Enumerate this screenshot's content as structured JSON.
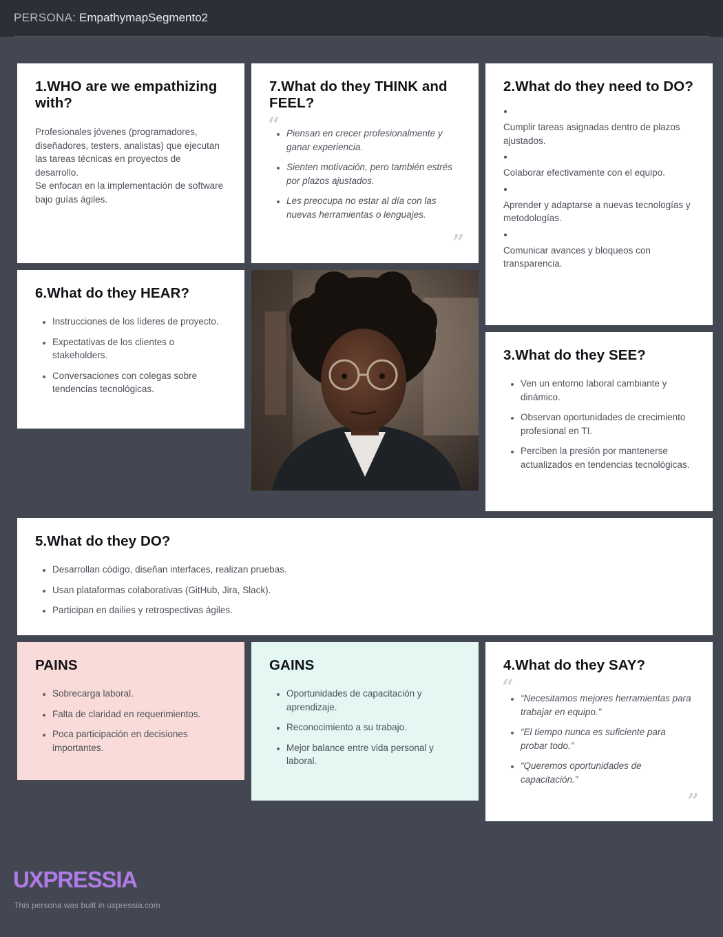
{
  "header": {
    "persona_label": "PERSONA:",
    "persona_name": "EmpathymapSegmento2"
  },
  "who": {
    "title": "1.WHO are we empathizing with?",
    "text_1": "Profesionales jóvenes (programadores, diseñadores, testers, analistas) que ejecutan las tareas técnicas en proyectos de desarrollo.",
    "text_2": "Se enfocan en la implementación de software bajo guías ágiles."
  },
  "think_feel": {
    "title": "7.What do they THINK and FEEL?",
    "items": [
      "Piensan en crecer profesionalmente y ganar experiencia.",
      "Sienten motivación, pero también estrés por plazos ajustados.",
      "Les preocupa no estar al día con las nuevas herramientas o lenguajes."
    ]
  },
  "need_to_do": {
    "title": "2.What do they need to DO?",
    "items": [
      "Cumplir tareas asignadas dentro de plazos ajustados.",
      "Colaborar efectivamente con el equipo.",
      "Aprender y adaptarse a nuevas tecnologías y metodologías.",
      "Comunicar avances y bloqueos con transparencia."
    ]
  },
  "hear": {
    "title": "6.What do they HEAR?",
    "items": [
      "Instrucciones de los líderes de proyecto.",
      "Expectativas de los clientes o stakeholders.",
      "Conversaciones con colegas sobre tendencias tecnológicas."
    ]
  },
  "see": {
    "title": "3.What do they SEE?",
    "items": [
      "Ven un entorno laboral cambiante y dinámico.",
      "Observan oportunidades de crecimiento profesional en TI.",
      "Perciben la presión por mantenerse actualizados en tendencias tecnológicas."
    ]
  },
  "do": {
    "title": "5.What do they DO?",
    "items": [
      "Desarrollan código, diseñan interfaces, realizan pruebas.",
      "Usan plataformas colaborativas (GitHub, Jira, Slack).",
      "Participan en dailies y retrospectivas ágiles."
    ]
  },
  "pains": {
    "title": "PAINS",
    "bg": "#f9dcd9",
    "items": [
      "Sobrecarga laboral.",
      "Falta de claridad en requerimientos.",
      "Poca participación en decisiones importantes."
    ]
  },
  "gains": {
    "title": "GAINS",
    "bg": "#e4f7f2",
    "items": [
      "Oportunidades de capacitación y aprendizaje.",
      "Reconocimiento a su trabajo.",
      "Mejor balance entre vida personal y laboral."
    ]
  },
  "say": {
    "title": "4.What do they SAY?",
    "items": [
      "“Necesitamos mejores herramientas para trabajar en equipo.”",
      "“El tiempo nunca es suficiente para probar todo.”",
      "“Queremos oportunidades de capacitación.”"
    ]
  },
  "footer": {
    "logo": "UXPRESSIA",
    "note": "This persona was built in uxpressia.com",
    "logo_color": "#b07be6"
  },
  "colors": {
    "page_bg": "#424752",
    "header_bg": "#2c2f36",
    "card_bg": "#ffffff"
  },
  "icons": {
    "open_quote": "open-quote-icon",
    "close_quote": "close-quote-icon",
    "photo": "persona-photo"
  }
}
